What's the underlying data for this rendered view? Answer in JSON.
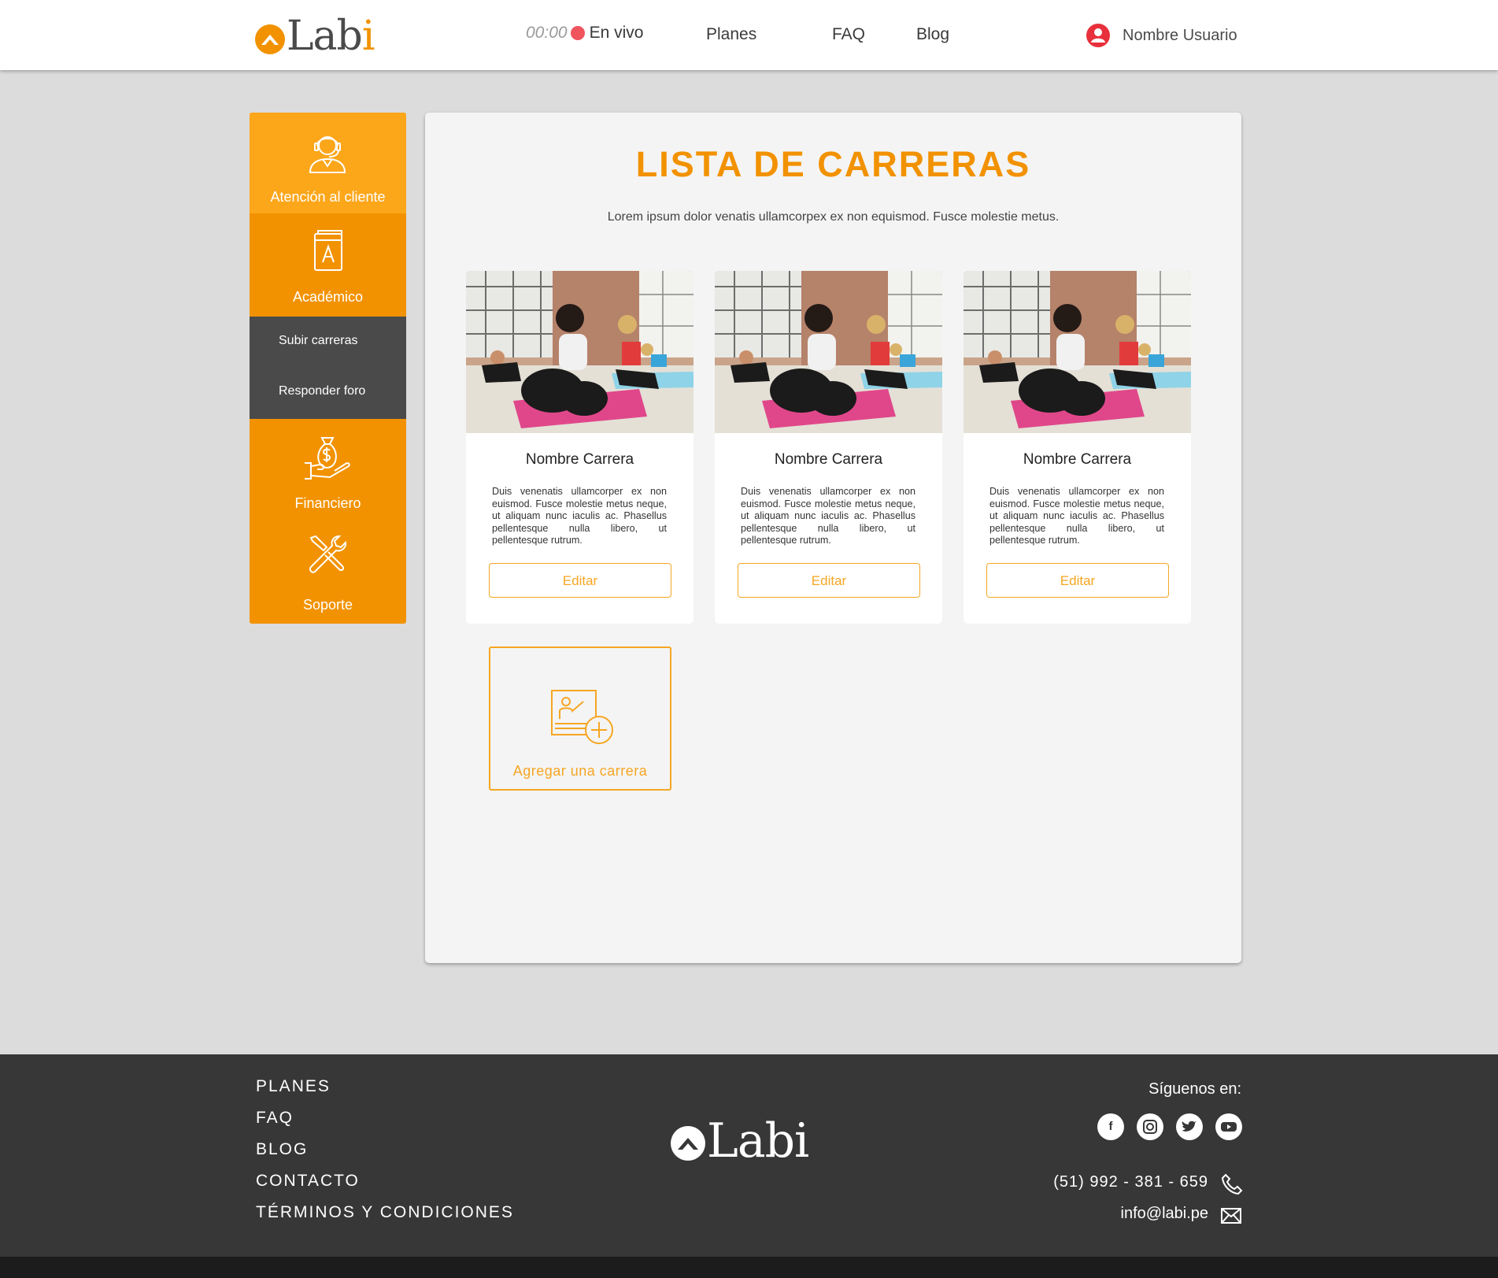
{
  "header": {
    "brand": "Lab",
    "brand_i": "i",
    "timer": "00:00",
    "live_label": "En vivo",
    "nav": [
      "Planes",
      "FAQ",
      "Blog"
    ],
    "user_name": "Nombre Usuario"
  },
  "sidebar": {
    "items": [
      {
        "label": "Atención al cliente",
        "icon": "headset-icon"
      },
      {
        "label": "Académico",
        "icon": "book-icon"
      },
      {
        "label": "Financiero",
        "icon": "money-bag-icon"
      },
      {
        "label": "Soporte",
        "icon": "tools-icon"
      }
    ],
    "submenu": [
      "Subir carreras",
      "Responder foro"
    ]
  },
  "main": {
    "title": "LISTA DE CARRERAS",
    "subtitle": "Lorem ipsum dolor venatis ullamcorpex ex non equismod. Fusce molestie metus.",
    "cards": [
      {
        "title": "Nombre Carrera",
        "description": "Duis venenatis ullamcorper ex non euismod. Fusce molestie metus neque, ut aliquam nunc iaculis ac. Phasellus pellentesque nulla libero, ut pellentesque rutrum.",
        "button": "Editar"
      },
      {
        "title": "Nombre Carrera",
        "description": "Duis venenatis ullamcorper ex non euismod. Fusce molestie metus neque, ut aliquam nunc iaculis ac. Phasellus pellentesque nulla libero, ut pellentesque rutrum.",
        "button": "Editar"
      },
      {
        "title": "Nombre Carrera",
        "description": "Duis venenatis ullamcorper ex non euismod. Fusce molestie metus neque, ut aliquam nunc iaculis ac. Phasellus pellentesque nulla libero, ut pellentesque rutrum.",
        "button": "Editar"
      }
    ],
    "add_label": "Agregar una carrera"
  },
  "footer": {
    "links": [
      "PLANES",
      "FAQ",
      "BLOG",
      "CONTACTO",
      "TÉRMINOS Y CONDICIONES"
    ],
    "brand": "Labi",
    "follow": "Síguenos en:",
    "socials": [
      "facebook-icon",
      "instagram-icon",
      "twitter-icon",
      "youtube-icon"
    ],
    "phone": "(51) 992 - 381 - 659",
    "email": "info@labi.pe"
  },
  "colors": {
    "accent": "#f29200",
    "accent_light": "#fca61a",
    "button_orange": "#f6a623",
    "submenu_bg": "#4a4a4a",
    "footer_bg": "#373737",
    "live_dot": "#f0545d"
  }
}
